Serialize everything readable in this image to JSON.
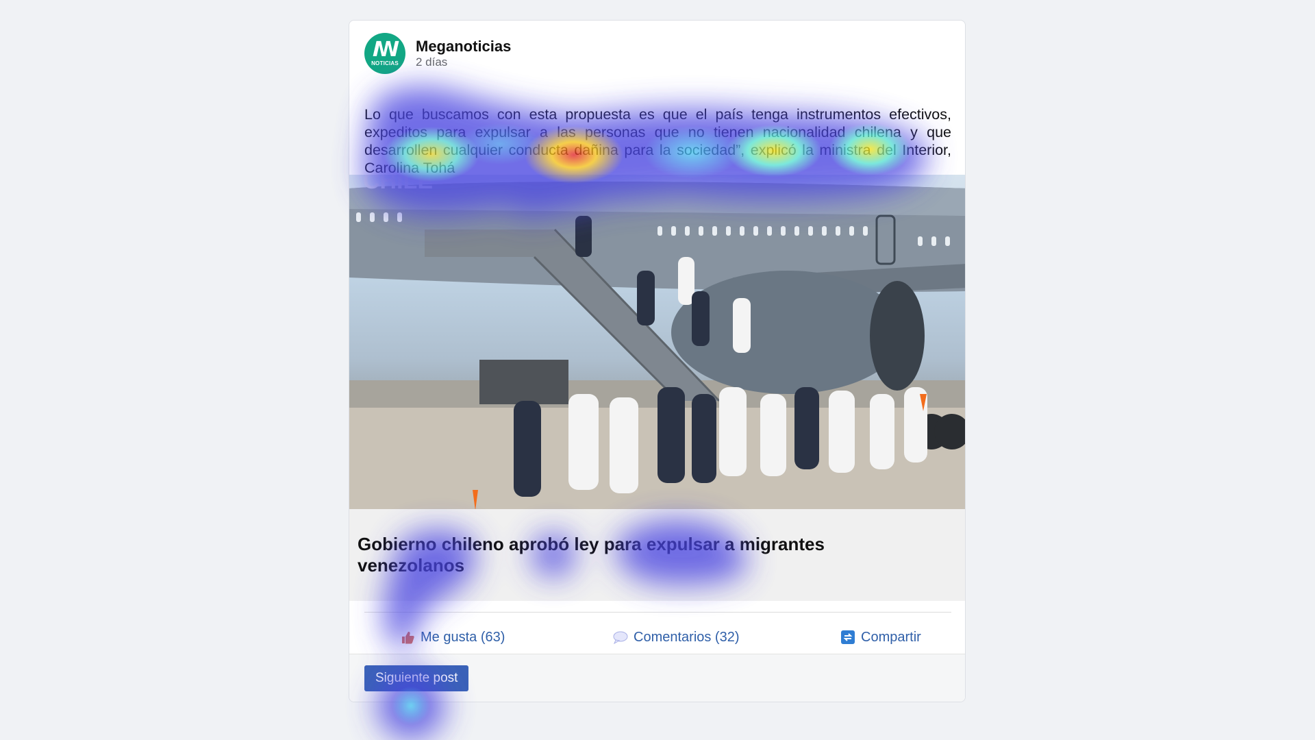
{
  "post": {
    "source": "Meganoticias",
    "time": "2 días",
    "avatar_text": "NOTICIAS",
    "text": "Lo que buscamos con esta propuesta es que el país tenga instrumentos efectivos, expeditos para expulsar a las personas que no tienen nacionalidad chilena y que desarrollen cualquier conducta dañina para la sociedad”, explicó la ministra del Interior, Carolina Tohá",
    "photo_text": "CHILE",
    "link_title": "Gobierno chileno aprobó ley para expulsar a migrantes venezolanos"
  },
  "actions": {
    "like": "Me gusta (63)",
    "comment": "Comentarios (32)",
    "share": "Compartir"
  },
  "footer": {
    "next_button": "Siguiente post"
  },
  "icons": {
    "avatar": "meganoticias-logo",
    "like": "thumbs-up-icon",
    "comment": "speech-bubble-icon",
    "share": "share-arrows-icon"
  },
  "colors": {
    "brand": "#12a784",
    "link": "#2f5fa8",
    "button": "#3b63b8"
  }
}
